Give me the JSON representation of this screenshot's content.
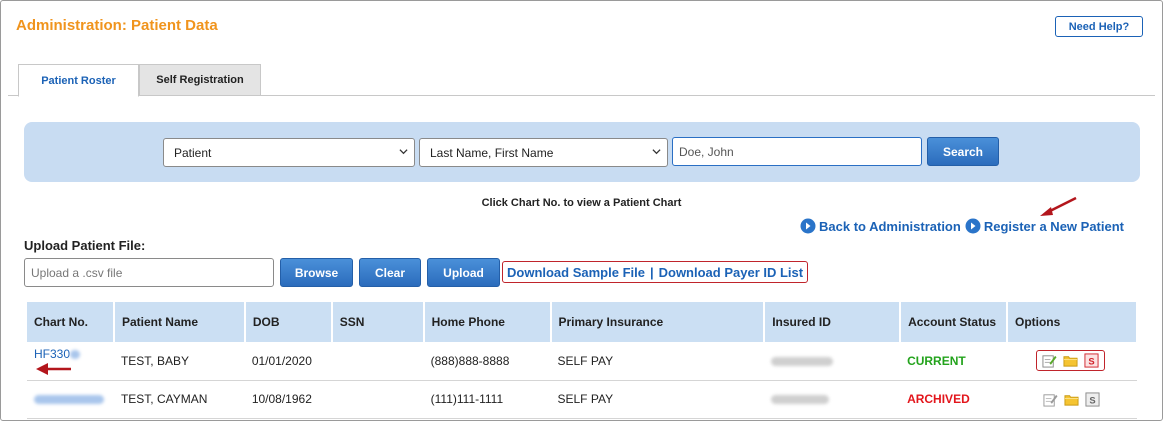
{
  "header": {
    "title": "Administration: Patient Data",
    "help_label": "Need Help?"
  },
  "tabs": [
    {
      "label": "Patient Roster",
      "active": true
    },
    {
      "label": "Self Registration",
      "active": false
    }
  ],
  "search": {
    "type_value": "Patient",
    "format_value": "Last Name, First Name",
    "placeholder": "Doe, John",
    "button_label": "Search"
  },
  "hint": "Click Chart No. to view a Patient Chart",
  "nav": {
    "back_label": "Back to Administration",
    "register_label": "Register a New Patient"
  },
  "upload": {
    "label": "Upload Patient File:",
    "placeholder": "Upload a .csv file",
    "browse_label": "Browse",
    "clear_label": "Clear",
    "upload_label": "Upload",
    "sample_link": "Download Sample File",
    "separator": "|",
    "payer_link": "Download Payer ID List"
  },
  "table": {
    "columns": [
      "Chart No.",
      "Patient Name",
      "DOB",
      "SSN",
      "Home Phone",
      "Primary Insurance",
      "Insured ID",
      "Account Status",
      "Options"
    ],
    "rows": [
      {
        "chart_no": "HF330",
        "name": "TEST, BABY",
        "dob": "01/01/2020",
        "ssn": "",
        "phone": "(888)888-8888",
        "insurance": "SELF PAY",
        "status": "CURRENT"
      },
      {
        "chart_no": "",
        "name": "TEST, CAYMAN",
        "dob": "10/08/1962",
        "ssn": "",
        "phone": "(111)111-1111",
        "insurance": "SELF PAY",
        "status": "ARCHIVED"
      }
    ]
  },
  "colors": {
    "title": "#f0941d",
    "link": "#1b62b6",
    "current": "#23a31c",
    "archived": "#e3161c",
    "highlight": "#c0242b",
    "panel": "#c8dcf2"
  },
  "icons": [
    "edit-icon",
    "folder-icon",
    "s-badge-icon",
    "circle-arrow-icon",
    "chevron-down-icon"
  ]
}
